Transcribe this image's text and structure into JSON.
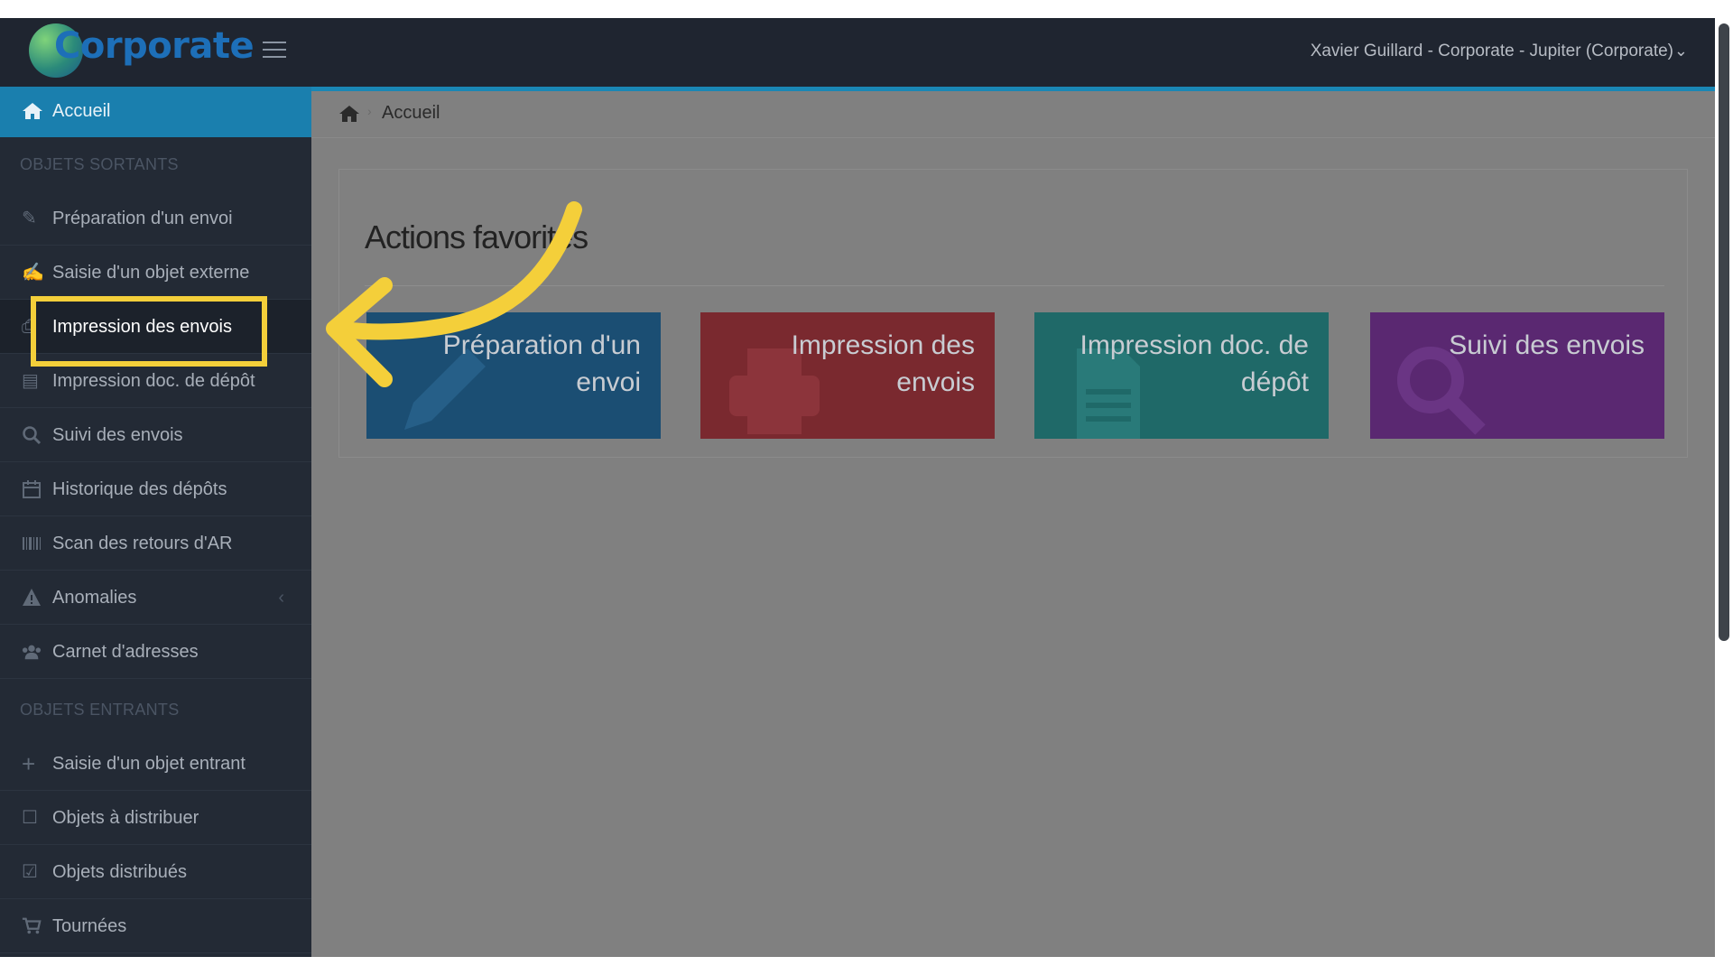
{
  "brand": {
    "logo_text": "Corporate"
  },
  "topbar": {
    "user_label": "Xavier Guillard - Corporate - Jupiter (Corporate)"
  },
  "sidebar": {
    "active_item": {
      "label": "Accueil",
      "icon": "home-icon"
    },
    "sections": [
      {
        "title": "OBJETS SORTANTS",
        "items": [
          {
            "label": "Préparation d'un envoi",
            "icon": "pencil-icon"
          },
          {
            "label": "Saisie d'un objet externe",
            "icon": "external-edit-icon"
          },
          {
            "label": "Impression des envois",
            "icon": "print-icon"
          },
          {
            "label": "Impression doc. de dépôt",
            "icon": "document-icon"
          },
          {
            "label": "Suivi des envois",
            "icon": "search-icon"
          },
          {
            "label": "Historique des dépôts",
            "icon": "calendar-icon"
          },
          {
            "label": "Scan des retours d'AR",
            "icon": "barcode-icon"
          },
          {
            "label": "Anomalies",
            "icon": "warning-icon",
            "has_submenu": true
          },
          {
            "label": "Carnet d'adresses",
            "icon": "users-icon"
          }
        ]
      },
      {
        "title": "OBJETS ENTRANTS",
        "items": [
          {
            "label": "Saisie d'un objet entrant",
            "icon": "plus-icon"
          },
          {
            "label": "Objets à distribuer",
            "icon": "checkbox-empty-icon"
          },
          {
            "label": "Objets distribués",
            "icon": "checkbox-checked-icon"
          },
          {
            "label": "Tournées",
            "icon": "cart-icon"
          }
        ]
      }
    ]
  },
  "breadcrumb": {
    "current": "Accueil"
  },
  "main": {
    "panel_title": "Actions favorites",
    "tiles": [
      {
        "label_line1": "Préparation d'un",
        "label_line2": "envoi",
        "color": "#1b4e73",
        "icon": "pencil-icon"
      },
      {
        "label_line1": "Impression des",
        "label_line2": "envois",
        "color": "#7a292f",
        "icon": "print-icon"
      },
      {
        "label_line1": "Impression doc. de",
        "label_line2": "dépôt",
        "color": "#1f6968",
        "icon": "document-icon"
      },
      {
        "label_line1": "Suivi des envois",
        "label_line2": "",
        "color": "#5a2871",
        "icon": "search-icon"
      }
    ]
  },
  "annotation": {
    "highlight_color": "#f4cf3a",
    "target": "Impression des envois"
  }
}
